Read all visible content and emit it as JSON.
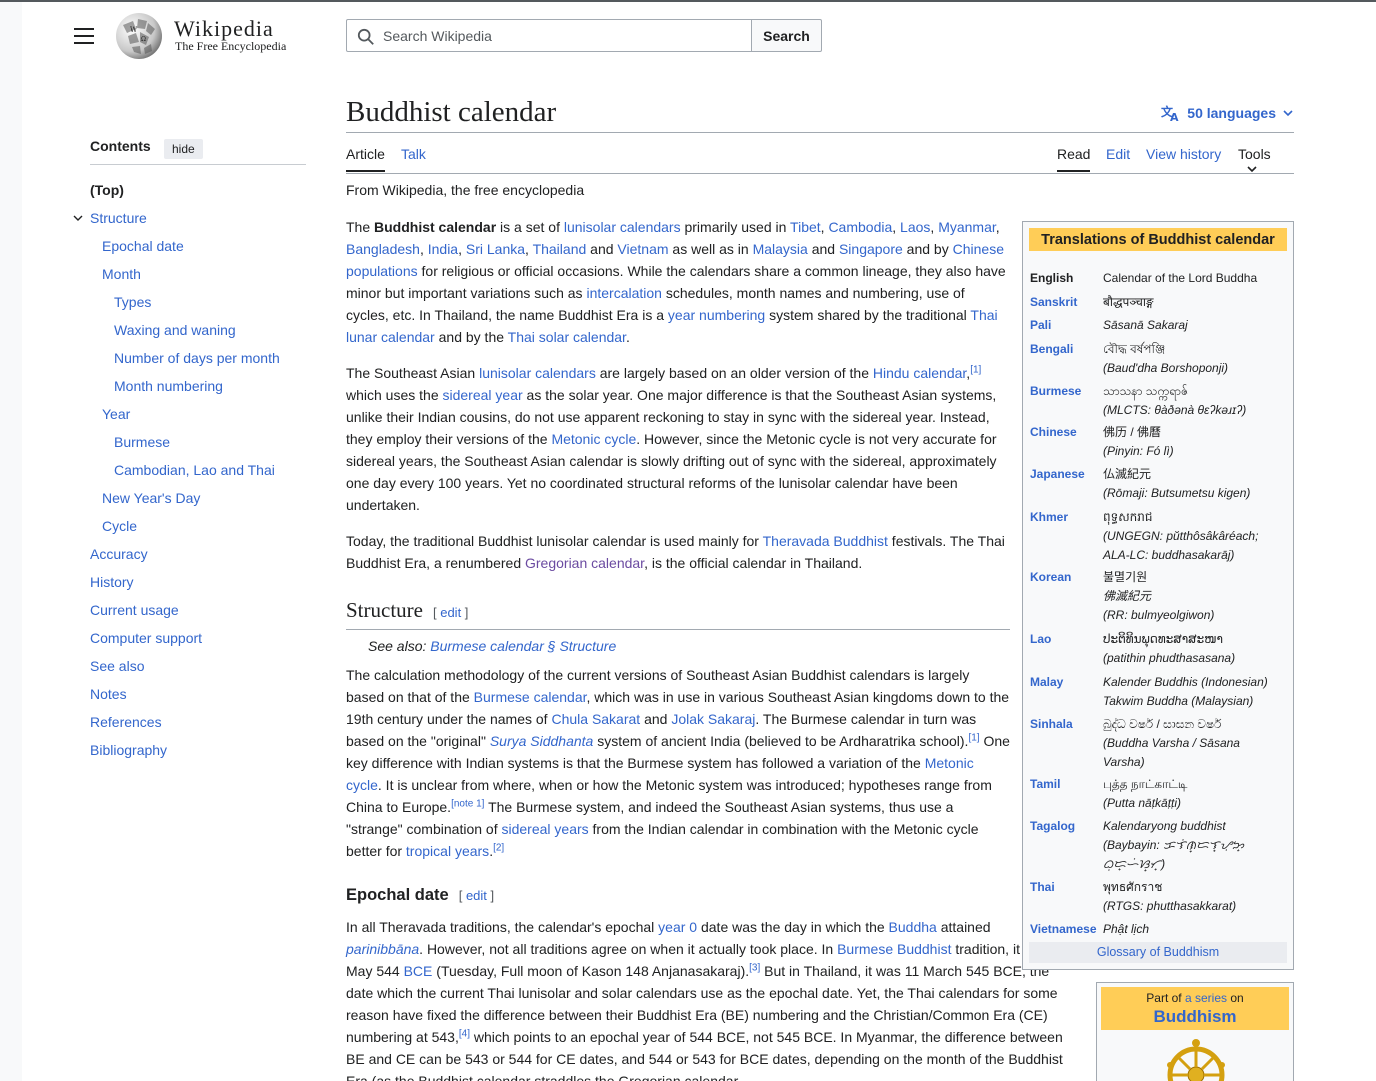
{
  "header": {
    "wordmark": "Wikipedia",
    "tagline": "The Free Encyclopedia",
    "search_placeholder": "Search Wikipedia",
    "search_button": "Search"
  },
  "toc": {
    "title": "Contents",
    "hide": "hide",
    "items": [
      {
        "label": "(Top)",
        "level": 1
      },
      {
        "label": "Structure",
        "level": 1
      },
      {
        "label": "Epochal date",
        "level": 2
      },
      {
        "label": "Month",
        "level": 2
      },
      {
        "label": "Types",
        "level": 3
      },
      {
        "label": "Waxing and waning",
        "level": 3
      },
      {
        "label": "Number of days per month",
        "level": 3
      },
      {
        "label": "Month numbering",
        "level": 3
      },
      {
        "label": "Year",
        "level": 2
      },
      {
        "label": "Burmese",
        "level": 3
      },
      {
        "label": "Cambodian, Lao and Thai",
        "level": 3
      },
      {
        "label": "New Year's Day",
        "level": 2
      },
      {
        "label": "Cycle",
        "level": 2
      },
      {
        "label": "Accuracy",
        "level": 1
      },
      {
        "label": "History",
        "level": 1
      },
      {
        "label": "Current usage",
        "level": 1
      },
      {
        "label": "Computer support",
        "level": 1
      },
      {
        "label": "See also",
        "level": 1
      },
      {
        "label": "Notes",
        "level": 1
      },
      {
        "label": "References",
        "level": 1
      },
      {
        "label": "Bibliography",
        "level": 1
      }
    ]
  },
  "article": {
    "title": "Buddhist calendar",
    "languages": "50 languages",
    "tabs_left": [
      "Article",
      "Talk"
    ],
    "tabs_right": [
      "Read",
      "Edit",
      "View history",
      "Tools"
    ],
    "from": "From Wikipedia, the free encyclopedia",
    "h2_structure": "Structure",
    "edit": "edit",
    "see_also_prefix": "See also: ",
    "see_also_link": "Burmese calendar § Structure",
    "h3_epochal": "Epochal date"
  },
  "infobox": {
    "title": "Translations of Buddhist calendar",
    "footer": "Glossary of Buddhism",
    "rows": [
      {
        "lang": "English",
        "lines": [
          "Calendar of the Lord Buddha"
        ]
      },
      {
        "lang": "Sanskrit",
        "lines": [
          "बौद्धपञ्चाङ्ग"
        ]
      },
      {
        "lang": "Pali",
        "lines": [
          "Sāsanā Sakaraj"
        ]
      },
      {
        "lang": "Bengali",
        "lines": [
          "বৌদ্ধ বর্ষপঞ্জি",
          "(Baud'dha Borshoponji)"
        ]
      },
      {
        "lang": "Burmese",
        "lines": [
          "သာသနာ သက္ကရာဇ်",
          "(MLCTS: θàðənà θɛʔkəɹɪʔ)"
        ]
      },
      {
        "lang": "Chinese",
        "lines": [
          "佛历 / 佛曆",
          "(Pinyin: Fó lì)"
        ]
      },
      {
        "lang": "Japanese",
        "lines": [
          "仏滅紀元",
          "(Rōmaji: Butsumetsu kigen)"
        ]
      },
      {
        "lang": "Khmer",
        "lines": [
          "ពុទ្ធសករាជ",
          "(UNGEGN: pŭtthôsâkâréach;",
          "ALA-LC: buddhasakarāj)"
        ]
      },
      {
        "lang": "Korean",
        "lines": [
          "불멸기원",
          "佛滅紀元",
          "(RR: bulmyeolgiwon)"
        ]
      },
      {
        "lang": "Lao",
        "lines": [
          "ປະຕິທິນພຸດທະສາສະໜາ",
          "(patithin phudthasasana)"
        ]
      },
      {
        "lang": "Malay",
        "lines": [
          "Kalender Buddhis (Indonesian)",
          "Takwim Buddha (Malaysian)"
        ]
      },
      {
        "lang": "Sinhala",
        "lines": [
          "බුද්ධ වර්ෂ / සාසන වර්ෂ",
          "(Buddha Varsha / Sāsana",
          "Varsha)"
        ]
      },
      {
        "lang": "Tamil",
        "lines": [
          "புத்த நாட்காட்டி",
          "(Putta nāṭkāṭṭi)"
        ]
      },
      {
        "lang": "Tagalog",
        "lines": [
          "Kalendaryong buddhist",
          "(Baybayin: ᜃᜎᜒᜈ᜔ᜇᜎ᜔ᜌᜓᜅ᜔ ᜊᜓᜇ᜔ᜑᜒᜐ᜔ᜆ᜔)"
        ]
      },
      {
        "lang": "Thai",
        "lines": [
          "พุทธศักราช",
          "(RTGS: phutthasakkarat)"
        ]
      },
      {
        "lang": "Vietnamese",
        "lines": [
          "Phật lịch"
        ]
      }
    ]
  },
  "series": {
    "part_of": "Part of",
    "a_series": "a series",
    "on": "on",
    "topic": "Buddhism"
  },
  "colors": {
    "link": "#3366cc",
    "visited": "#6b4ba1",
    "infobox_header": "#ffcd57",
    "border": "#a2a9b1"
  }
}
